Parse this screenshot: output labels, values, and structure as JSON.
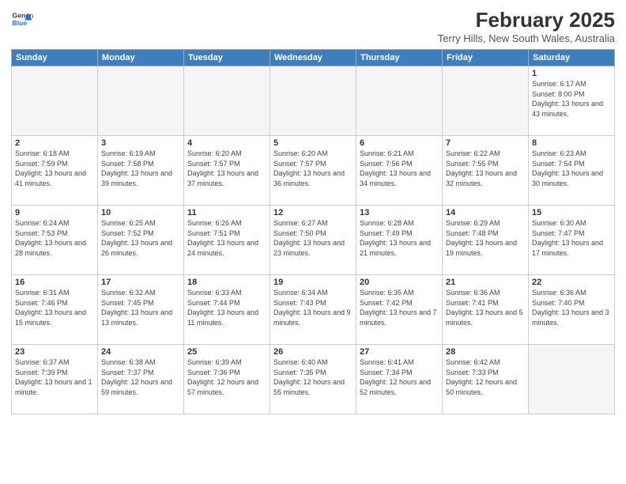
{
  "header": {
    "logo_line1": "General",
    "logo_line2": "Blue",
    "title": "February 2025",
    "subtitle": "Terry Hills, New South Wales, Australia"
  },
  "calendar": {
    "days_of_week": [
      "Sunday",
      "Monday",
      "Tuesday",
      "Wednesday",
      "Thursday",
      "Friday",
      "Saturday"
    ],
    "weeks": [
      [
        {
          "day": "",
          "empty": true
        },
        {
          "day": "",
          "empty": true
        },
        {
          "day": "",
          "empty": true
        },
        {
          "day": "",
          "empty": true
        },
        {
          "day": "",
          "empty": true
        },
        {
          "day": "",
          "empty": true
        },
        {
          "day": "1",
          "rise": "6:17 AM",
          "set": "8:00 PM",
          "daylight": "13 hours and 43 minutes."
        }
      ],
      [
        {
          "day": "2",
          "rise": "6:18 AM",
          "set": "7:59 PM",
          "daylight": "13 hours and 41 minutes."
        },
        {
          "day": "3",
          "rise": "6:19 AM",
          "set": "7:58 PM",
          "daylight": "13 hours and 39 minutes."
        },
        {
          "day": "4",
          "rise": "6:20 AM",
          "set": "7:57 PM",
          "daylight": "13 hours and 37 minutes."
        },
        {
          "day": "5",
          "rise": "6:20 AM",
          "set": "7:57 PM",
          "daylight": "13 hours and 36 minutes."
        },
        {
          "day": "6",
          "rise": "6:21 AM",
          "set": "7:56 PM",
          "daylight": "13 hours and 34 minutes."
        },
        {
          "day": "7",
          "rise": "6:22 AM",
          "set": "7:55 PM",
          "daylight": "13 hours and 32 minutes."
        },
        {
          "day": "8",
          "rise": "6:23 AM",
          "set": "7:54 PM",
          "daylight": "13 hours and 30 minutes."
        }
      ],
      [
        {
          "day": "9",
          "rise": "6:24 AM",
          "set": "7:53 PM",
          "daylight": "13 hours and 28 minutes."
        },
        {
          "day": "10",
          "rise": "6:25 AM",
          "set": "7:52 PM",
          "daylight": "13 hours and 26 minutes."
        },
        {
          "day": "11",
          "rise": "6:26 AM",
          "set": "7:51 PM",
          "daylight": "13 hours and 24 minutes."
        },
        {
          "day": "12",
          "rise": "6:27 AM",
          "set": "7:50 PM",
          "daylight": "13 hours and 23 minutes."
        },
        {
          "day": "13",
          "rise": "6:28 AM",
          "set": "7:49 PM",
          "daylight": "13 hours and 21 minutes."
        },
        {
          "day": "14",
          "rise": "6:29 AM",
          "set": "7:48 PM",
          "daylight": "13 hours and 19 minutes."
        },
        {
          "day": "15",
          "rise": "6:30 AM",
          "set": "7:47 PM",
          "daylight": "13 hours and 17 minutes."
        }
      ],
      [
        {
          "day": "16",
          "rise": "6:31 AM",
          "set": "7:46 PM",
          "daylight": "13 hours and 15 minutes."
        },
        {
          "day": "17",
          "rise": "6:32 AM",
          "set": "7:45 PM",
          "daylight": "13 hours and 13 minutes."
        },
        {
          "day": "18",
          "rise": "6:33 AM",
          "set": "7:44 PM",
          "daylight": "13 hours and 11 minutes."
        },
        {
          "day": "19",
          "rise": "6:34 AM",
          "set": "7:43 PM",
          "daylight": "13 hours and 9 minutes."
        },
        {
          "day": "20",
          "rise": "6:35 AM",
          "set": "7:42 PM",
          "daylight": "13 hours and 7 minutes."
        },
        {
          "day": "21",
          "rise": "6:36 AM",
          "set": "7:41 PM",
          "daylight": "13 hours and 5 minutes."
        },
        {
          "day": "22",
          "rise": "6:36 AM",
          "set": "7:40 PM",
          "daylight": "13 hours and 3 minutes."
        }
      ],
      [
        {
          "day": "23",
          "rise": "6:37 AM",
          "set": "7:39 PM",
          "daylight": "13 hours and 1 minute."
        },
        {
          "day": "24",
          "rise": "6:38 AM",
          "set": "7:37 PM",
          "daylight": "12 hours and 59 minutes."
        },
        {
          "day": "25",
          "rise": "6:39 AM",
          "set": "7:36 PM",
          "daylight": "12 hours and 57 minutes."
        },
        {
          "day": "26",
          "rise": "6:40 AM",
          "set": "7:35 PM",
          "daylight": "12 hours and 55 minutes."
        },
        {
          "day": "27",
          "rise": "6:41 AM",
          "set": "7:34 PM",
          "daylight": "12 hours and 52 minutes."
        },
        {
          "day": "28",
          "rise": "6:42 AM",
          "set": "7:33 PM",
          "daylight": "12 hours and 50 minutes."
        },
        {
          "day": "",
          "empty": true
        }
      ]
    ]
  }
}
